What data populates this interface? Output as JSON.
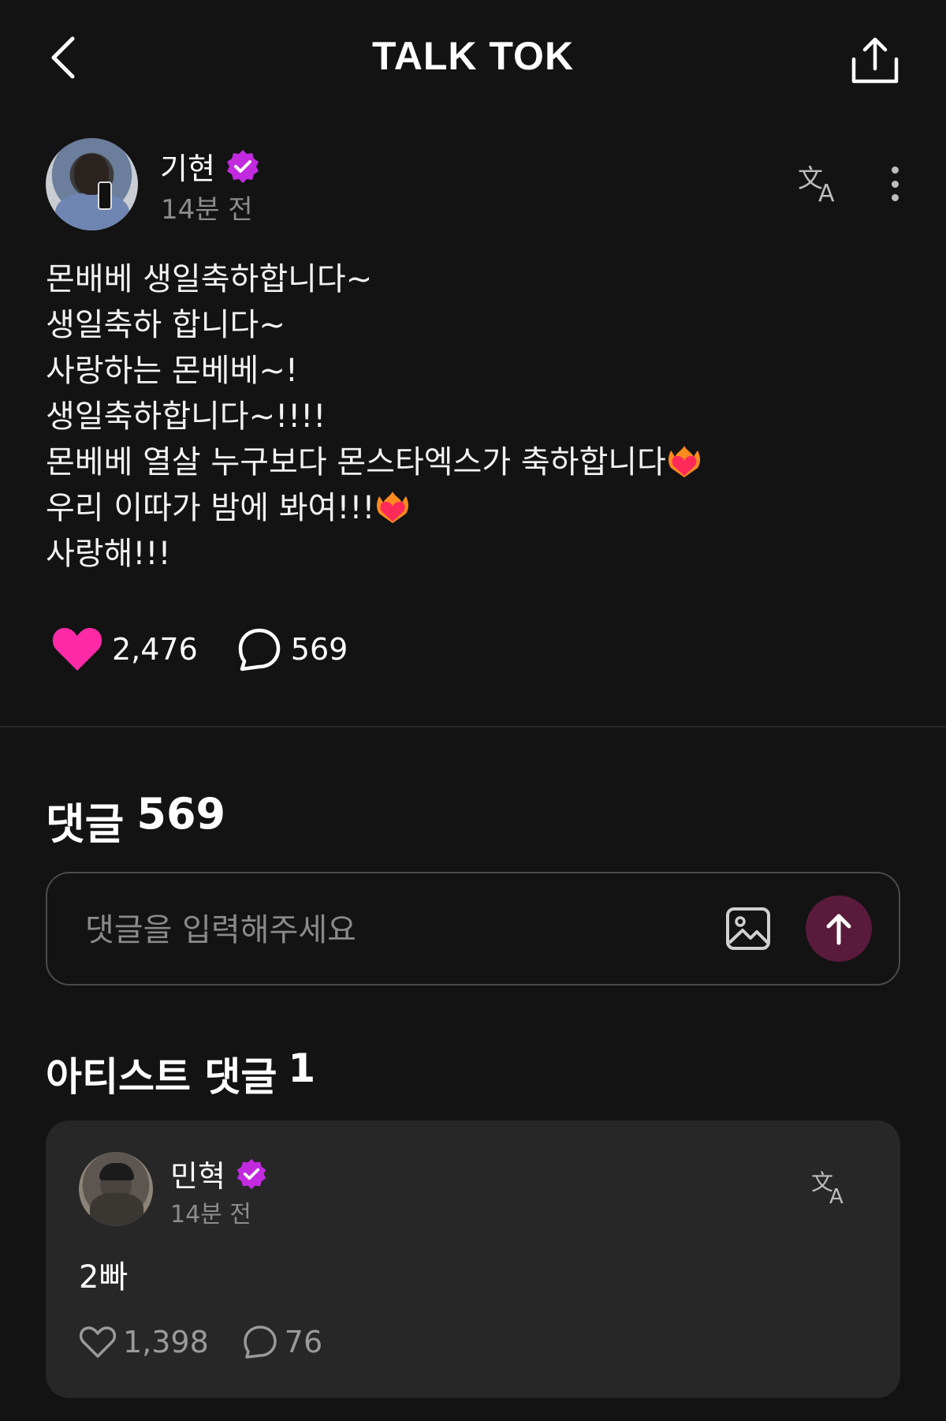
{
  "header": {
    "title": "TALK TOK"
  },
  "post": {
    "author": "기현",
    "time": "14분 전",
    "lines": [
      "몬배베 생일축하합니다~",
      "생일축하 합니다~",
      "사랑하는 몬베베~!",
      "생일축하합니다~!!!!",
      "몬베베 열살 누구보다 몬스타엑스가 축하합니다",
      "우리 이따가 밤에 봐여!!!",
      "사랑해!!!"
    ],
    "likes": "2,476",
    "comments": "569"
  },
  "comments_section": {
    "label": "댓글",
    "count": "569",
    "input_placeholder": "댓글을 입력해주세요"
  },
  "artist_comments": {
    "label": "아티스트 댓글",
    "count": "1",
    "items": [
      {
        "author": "민혁",
        "time": "14분 전",
        "text": "2빠",
        "likes": "1,398",
        "replies": "76"
      }
    ]
  },
  "colors": {
    "background": "#131313",
    "accent": "#ff2aa6",
    "badge": "#c22ae0",
    "send_button": "#5a1a3b"
  }
}
